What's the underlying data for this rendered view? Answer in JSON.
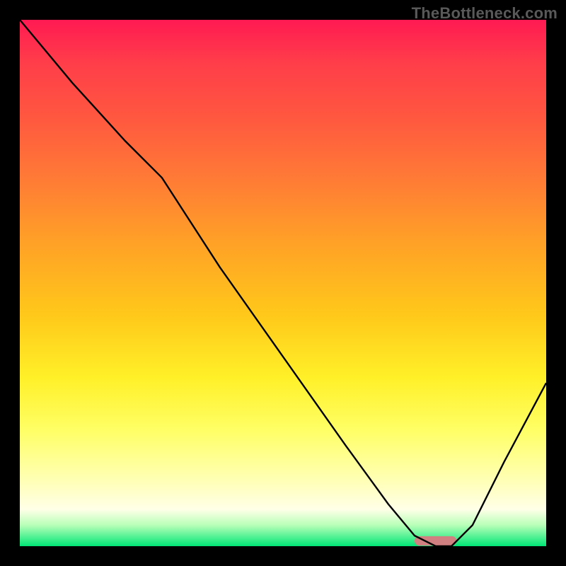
{
  "watermark": "TheBottleneck.com",
  "chart_data": {
    "type": "line",
    "title": "",
    "xlabel": "",
    "ylabel": "",
    "xlim": [
      0,
      100
    ],
    "ylim": [
      0,
      100
    ],
    "background_gradient": {
      "direction": "top-to-bottom",
      "stops": [
        {
          "pos": 0,
          "color": "#ff1a52"
        },
        {
          "pos": 30,
          "color": "#ff7a36"
        },
        {
          "pos": 68,
          "color": "#fff028"
        },
        {
          "pos": 93,
          "color": "#ffffe8"
        },
        {
          "pos": 100,
          "color": "#00e676"
        }
      ]
    },
    "series": [
      {
        "name": "bottleneck-curve",
        "color": "#000000",
        "x": [
          0,
          10,
          20,
          27,
          38,
          50,
          62,
          70,
          75,
          79,
          82,
          86,
          92,
          100
        ],
        "y": [
          100,
          88,
          77,
          70,
          53,
          36,
          19,
          8,
          2,
          0,
          0,
          4,
          16,
          31
        ]
      }
    ],
    "marker": {
      "name": "optimal-range",
      "color": "#d08080",
      "x_start": 75,
      "x_end": 83,
      "y": 1
    }
  }
}
